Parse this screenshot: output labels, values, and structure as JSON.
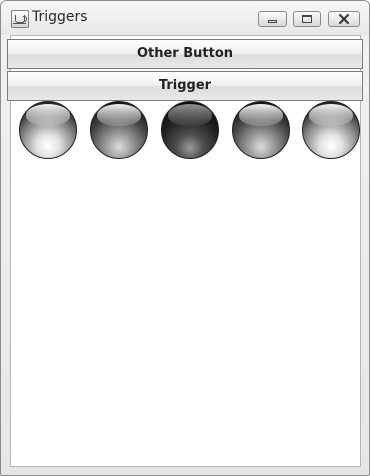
{
  "window": {
    "title": "Triggers",
    "app_icon": "java-cup-icon",
    "controls": [
      "minimize-icon",
      "maximize-icon",
      "close-icon"
    ]
  },
  "buttons": {
    "other": "Other Button",
    "trigger": "Trigger"
  },
  "indicators": [
    {
      "state": "light"
    },
    {
      "state": "mid"
    },
    {
      "state": "dark"
    },
    {
      "state": "mid"
    },
    {
      "state": "light"
    }
  ]
}
